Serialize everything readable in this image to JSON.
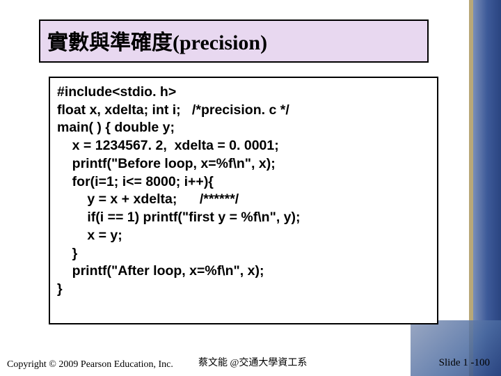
{
  "title": "實數與準確度(precision)",
  "code": "#include<stdio. h>\nfloat x, xdelta; int i;   /*precision. c */\nmain( ) { double y;\n    x = 1234567. 2,  xdelta = 0. 0001;  \n    printf(\"Before loop, x=%f\\n\", x);\n    for(i=1; i<= 8000; i++){\n        y = x + xdelta;      /******/\n        if(i == 1) printf(\"first y = %f\\n\", y);\n        x = y;\n    } \n    printf(\"After loop, x=%f\\n\", x);\n}",
  "footer": {
    "copyright": "Copyright © 2009 Pearson Education, Inc.",
    "author": "蔡文能 @交通大學資工系",
    "slide": "Slide 1 -100"
  }
}
